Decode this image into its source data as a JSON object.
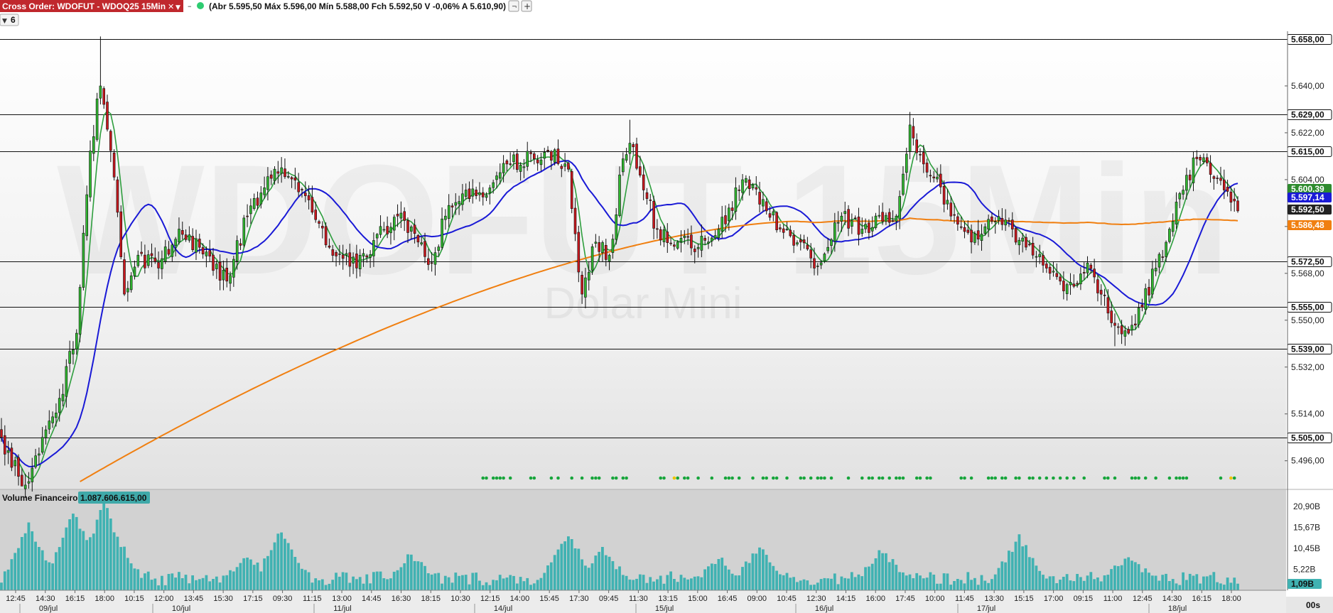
{
  "header": {
    "window_title": "Cross Order: WDOFUT - WDOQ25 15Min",
    "ohlc_text": "(Abr 5.595,50 Máx 5.596,00 Mín 5.588,00 Fch 5.592,50 V -0,06% A 5.610,90)",
    "collapse_label": "6",
    "colors": {
      "title_bg": "#c0282d",
      "status_dot": "#2ecc71"
    }
  },
  "watermark": {
    "symbol": "WDOFUT 15Min",
    "name": "Dolar Mini"
  },
  "chart_data": [
    {
      "type": "candlestick",
      "panel": "price",
      "ylim": [
        5485,
        5661
      ],
      "y_ticks": [
        "5.640,00",
        "5.622,00",
        "5.604,00",
        "5.586,00",
        "5.568,00",
        "5.550,00",
        "5.532,00",
        "5.514,00",
        "5.496,00"
      ],
      "y_tick_values": [
        5640,
        5622,
        5604,
        5586,
        5568,
        5550,
        5532,
        5514,
        5496
      ],
      "horizontal_levels": [
        {
          "value": 5658,
          "label": "5.658,00"
        },
        {
          "value": 5629,
          "label": "5.629,00"
        },
        {
          "value": 5615,
          "label": "5.615,00"
        },
        {
          "value": 5572.5,
          "label": "5.572,50"
        },
        {
          "value": 5555,
          "label": "5.555,00"
        },
        {
          "value": 5539,
          "label": "5.539,00"
        },
        {
          "value": 5505,
          "label": "5.505,00"
        }
      ],
      "price_tags": [
        {
          "value": 5600.39,
          "label": "5.600,39",
          "color": "#2e8b2e"
        },
        {
          "value": 5597.14,
          "label": "5.597,14",
          "color": "#1a1ad6"
        },
        {
          "value": 5592.5,
          "label": "5.592,50",
          "color": "#222222"
        },
        {
          "value": 5586.48,
          "label": "5.586,48",
          "color": "#f07f10"
        }
      ],
      "x_time_labels": [
        "12:45",
        "14:30",
        "16:15",
        "18:00",
        "10:15",
        "12:00",
        "13:45",
        "15:30",
        "17:15",
        "09:30",
        "11:15",
        "13:00",
        "14:45",
        "16:30",
        "18:15",
        "10:30",
        "12:15",
        "14:00",
        "15:45",
        "17:30",
        "09:45",
        "11:30",
        "13:15",
        "15:00",
        "16:45",
        "09:00",
        "10:45",
        "12:30",
        "14:15",
        "16:00",
        "17:45",
        "10:00",
        "11:45",
        "13:30",
        "15:15",
        "17:00",
        "09:15",
        "11:00",
        "12:45",
        "14:30",
        "16:15",
        "18:00"
      ],
      "x_date_labels": [
        "09/jul",
        "10/jul",
        "11/jul",
        "14/jul",
        "15/jul",
        "16/jul",
        "17/jul",
        "18/jul"
      ],
      "waypoints": [
        [
          0,
          5505
        ],
        [
          5,
          5490
        ],
        [
          8,
          5488
        ],
        [
          12,
          5505
        ],
        [
          17,
          5520
        ],
        [
          22,
          5545
        ],
        [
          26,
          5615
        ],
        [
          29,
          5640
        ],
        [
          33,
          5605
        ],
        [
          36,
          5560
        ],
        [
          40,
          5575
        ],
        [
          46,
          5570
        ],
        [
          52,
          5585
        ],
        [
          58,
          5578
        ],
        [
          66,
          5565
        ],
        [
          72,
          5590
        ],
        [
          80,
          5608
        ],
        [
          88,
          5600
        ],
        [
          96,
          5578
        ],
        [
          104,
          5570
        ],
        [
          110,
          5583
        ],
        [
          116,
          5590
        ],
        [
          122,
          5580
        ],
        [
          126,
          5572
        ],
        [
          130,
          5590
        ],
        [
          136,
          5600
        ],
        [
          142,
          5598
        ],
        [
          148,
          5610
        ],
        [
          156,
          5612
        ],
        [
          160,
          5615
        ],
        [
          166,
          5608
        ],
        [
          170,
          5560
        ],
        [
          174,
          5580
        ],
        [
          178,
          5575
        ],
        [
          182,
          5612
        ],
        [
          184,
          5618
        ],
        [
          188,
          5600
        ],
        [
          192,
          5585
        ],
        [
          198,
          5580
        ],
        [
          204,
          5578
        ],
        [
          210,
          5585
        ],
        [
          216,
          5600
        ],
        [
          220,
          5602
        ],
        [
          224,
          5592
        ],
        [
          228,
          5585
        ],
        [
          234,
          5580
        ],
        [
          238,
          5570
        ],
        [
          242,
          5578
        ],
        [
          246,
          5590
        ],
        [
          252,
          5585
        ],
        [
          258,
          5588
        ],
        [
          262,
          5590
        ],
        [
          266,
          5625
        ],
        [
          270,
          5610
        ],
        [
          274,
          5605
        ],
        [
          278,
          5590
        ],
        [
          284,
          5580
        ],
        [
          290,
          5588
        ],
        [
          296,
          5585
        ],
        [
          302,
          5575
        ],
        [
          306,
          5570
        ],
        [
          310,
          5565
        ],
        [
          314,
          5563
        ],
        [
          318,
          5572
        ],
        [
          322,
          5560
        ],
        [
          326,
          5548
        ],
        [
          330,
          5545
        ],
        [
          334,
          5555
        ],
        [
          338,
          5570
        ],
        [
          342,
          5585
        ],
        [
          346,
          5600
        ],
        [
          350,
          5612
        ],
        [
          354,
          5606
        ],
        [
          358,
          5600
        ],
        [
          362,
          5592
        ]
      ],
      "moving_averages": [
        {
          "name": "MA fast",
          "color": "#2e9e3e",
          "period": 5
        },
        {
          "name": "MA medium",
          "color": "#1a1ad6",
          "period": 20
        },
        {
          "name": "MA slow",
          "color": "#f07f10",
          "period": 200
        }
      ],
      "signal_colors": {
        "green": "#17a53b",
        "yellow": "#f0c400"
      }
    },
    {
      "type": "bar",
      "panel": "volume",
      "title": "Volume Financeiro",
      "current_label": "1.087.606.615,00",
      "ylim": [
        0,
        22.5
      ],
      "y_ticks": [
        "20,90B",
        "15,67B",
        "10,45B",
        "5,22B"
      ],
      "y_tick_values": [
        20.9,
        15.67,
        10.45,
        5.22
      ],
      "last_tag": "1,09B",
      "bar_color": "#40b2b2",
      "session_spikes": [
        [
          8,
          15
        ],
        [
          21,
          19
        ],
        [
          24,
          14
        ],
        [
          30,
          21
        ],
        [
          34,
          12
        ],
        [
          72,
          8
        ],
        [
          82,
          14
        ],
        [
          120,
          8
        ],
        [
          166,
          13
        ],
        [
          176,
          9
        ],
        [
          210,
          7
        ],
        [
          222,
          10
        ],
        [
          258,
          9
        ],
        [
          298,
          12
        ],
        [
          330,
          8
        ]
      ]
    }
  ],
  "countdown": "00s"
}
